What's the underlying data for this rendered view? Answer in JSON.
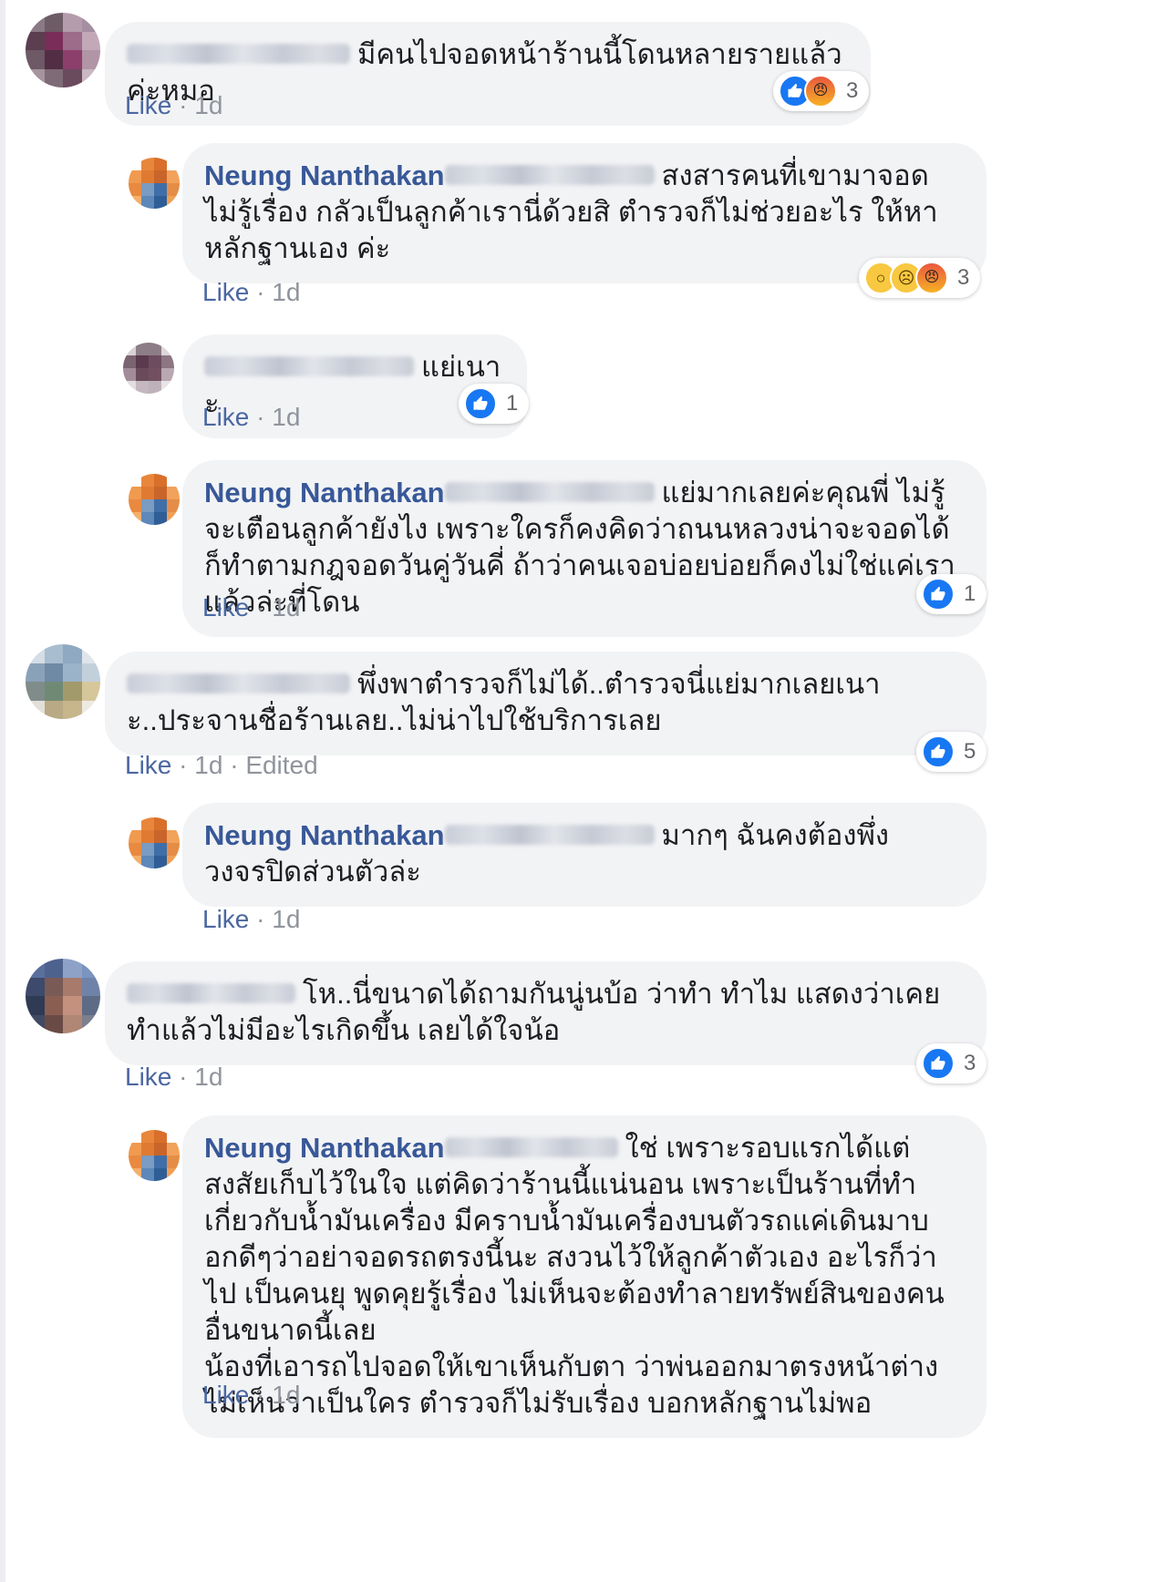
{
  "comments": [
    {
      "id": "c1",
      "level": "top",
      "author": "",
      "author_blurred": true,
      "text": "มีคนไปจอดหน้าร้านนี้โดนหลายรายแล้วค่ะหมอ",
      "actions": {
        "like": "Like",
        "time": "1d",
        "edited": ""
      },
      "reactions": {
        "types": [
          "like-icon",
          "angry-icon"
        ],
        "count": "3"
      },
      "avatar_colors": [
        "#8a7a85",
        "#6d5b66",
        "#b59cad",
        "#a48fa0",
        "#5b3e4f",
        "#7a2d58",
        "#9c6c8a",
        "#c3a8b8",
        "#6e5966",
        "#512e44",
        "#8d3f6c",
        "#b194a6",
        "#a5949e",
        "#7f6a78",
        "#6a4a5d",
        "#c9b7c1"
      ]
    },
    {
      "id": "c2",
      "level": "reply",
      "author": "Neung Nanthakan",
      "author_blurred": false,
      "text": "สงสารคนที่เขามาจอดไม่รู้เรื่อง กลัวเป็นลูกค้าเรานี่ด้วยสิ ตำรวจก็ไม่ช่วยอะไร ให้หาหลักฐานเอง ค่ะ",
      "actions": {
        "like": "Like",
        "time": "1d",
        "edited": ""
      },
      "reactions": {
        "types": [
          "wow-icon",
          "sad-icon",
          "angry-icon"
        ],
        "count": "3"
      }
    },
    {
      "id": "c3",
      "level": "reply",
      "author": "",
      "author_blurred": true,
      "text": "แย่เนาะ",
      "actions": {
        "like": "Like",
        "time": "1d",
        "edited": ""
      },
      "reactions": {
        "types": [
          "like-icon"
        ],
        "count": "1"
      },
      "avatar_colors": [
        "#d8d2d6",
        "#8d7d86",
        "#8d7d86",
        "#ddd6da",
        "#7a6471",
        "#5a3a4c",
        "#6d4c5f",
        "#8b7682",
        "#a38c99",
        "#6a4b5c",
        "#73505f",
        "#b9a7b1",
        "#e3dde0",
        "#c4b7bf",
        "#bfb1ba",
        "#e8e3e6"
      ]
    },
    {
      "id": "c4",
      "level": "reply",
      "author": "Neung Nanthakan",
      "author_blurred": false,
      "text": "แย่มากเลยค่ะคุณพี่ ไม่รู้จะเตือนลูกค้ายังไง เพราะใครก็คงคิดว่าถนนหลวงน่าจะจอดได้ ก็ทำตามกฎจอดวันคู่วันคี่ ถ้าว่าคนเจอบ่อยบ่อยก็คงไม่ใช่แค่เราแล้วล่ะที่โดน",
      "actions": {
        "like": "Like",
        "time": "1d",
        "edited": ""
      },
      "reactions": {
        "types": [
          "like-icon"
        ],
        "count": "1"
      }
    },
    {
      "id": "c5",
      "level": "top",
      "author": "",
      "author_blurred": true,
      "text": "พึ่งพาตำรวจก็ไม่ได้..ตำรวจนี่แย่มากเลยเนาะ..ประจานชื่อร้านเลย..ไม่น่าไปใช้บริการเลย",
      "actions": {
        "like": "Like",
        "time": "1d",
        "edited": "Edited"
      },
      "reactions": {
        "types": [
          "like-icon"
        ],
        "count": "5"
      },
      "avatar_colors": [
        "#d5dde6",
        "#a9bdd0",
        "#8fa9c2",
        "#dfe5eb",
        "#8aa2b8",
        "#6f8aa4",
        "#9bb3c8",
        "#c2d0dc",
        "#7f8c8a",
        "#6f8a74",
        "#a39a6c",
        "#d6c79a",
        "#e3e0d9",
        "#b9a984",
        "#c7b58c",
        "#eeeae2"
      ]
    },
    {
      "id": "c6",
      "level": "reply",
      "author": "Neung Nanthakan",
      "author_blurred": false,
      "text": "มากๆ ฉันคงต้องพึ่งวงจรปิดส่วนตัวล่ะ",
      "actions": {
        "like": "Like",
        "time": "1d",
        "edited": ""
      },
      "reactions": null
    },
    {
      "id": "c7",
      "level": "top",
      "author": "",
      "author_blurred": true,
      "text": "โห..นี่ขนาดได้ถามกันนู่นบ้อ ว่าทำ ทำไม แสดงว่าเคยทำแล้วไม่มีอะไรเกิดขึ้น เลยได้ใจน้อ",
      "actions": {
        "like": "Like",
        "time": "1d",
        "edited": ""
      },
      "reactions": {
        "types": [
          "like-icon"
        ],
        "count": "3"
      },
      "avatar_colors": [
        "#5a6f9c",
        "#4e628e",
        "#8da2c6",
        "#7a93bf",
        "#3d4a6b",
        "#7a5a55",
        "#a77a6c",
        "#6f83a9",
        "#2f3a55",
        "#8b5e52",
        "#c4917f",
        "#5e6b86",
        "#3f4a62",
        "#6a4a45",
        "#b08675",
        "#7c7f8d"
      ]
    },
    {
      "id": "c8",
      "level": "reply",
      "author": "Neung Nanthakan",
      "author_blurred": false,
      "text": "ใช่ เพราะรอบแรกได้แต่สงสัยเก็บไว้ในใจ แต่คิดว่าร้านนี้แน่นอน เพราะเป็นร้านที่ทำเกี่ยวกับน้ำมันเครื่อง มีคราบน้ำมันเครื่องบนตัวรถแค่เดินมาบอกดีๆว่าอย่าจอดรถตรงนี้นะ สงวนไว้ให้ลูกค้าตัวเอง อะไรก็ว่าไป เป็นคนยุ พูดคุยรู้เรื่อง ไม่เห็นจะต้องทำลายทรัพย์สินของคนอื่นขนาดนี้เลย\nน้องที่เอารถไปจอดให้เขาเห็นกับตา ว่าพ่นออกมาตรงหน้าต่าง ไม่เห็นว่าเป็นใคร ตำรวจก็ไม่รับเรื่อง บอกหลักฐานไม่พอ",
      "actions": {
        "like": "Like",
        "time": "1d",
        "edited": ""
      },
      "reactions": null
    }
  ],
  "reply_avatar_colors": [
    "#ffffff",
    "#e8873c",
    "#d96f2a",
    "#ffffff",
    "#f09a4f",
    "#e07a32",
    "#c9652a",
    "#f2a25a",
    "#e88a40",
    "#7a9bc2",
    "#3f6fa8",
    "#e58d46",
    "#f4b06a",
    "#5e87ba",
    "#2f5e97",
    "#f0a055"
  ]
}
